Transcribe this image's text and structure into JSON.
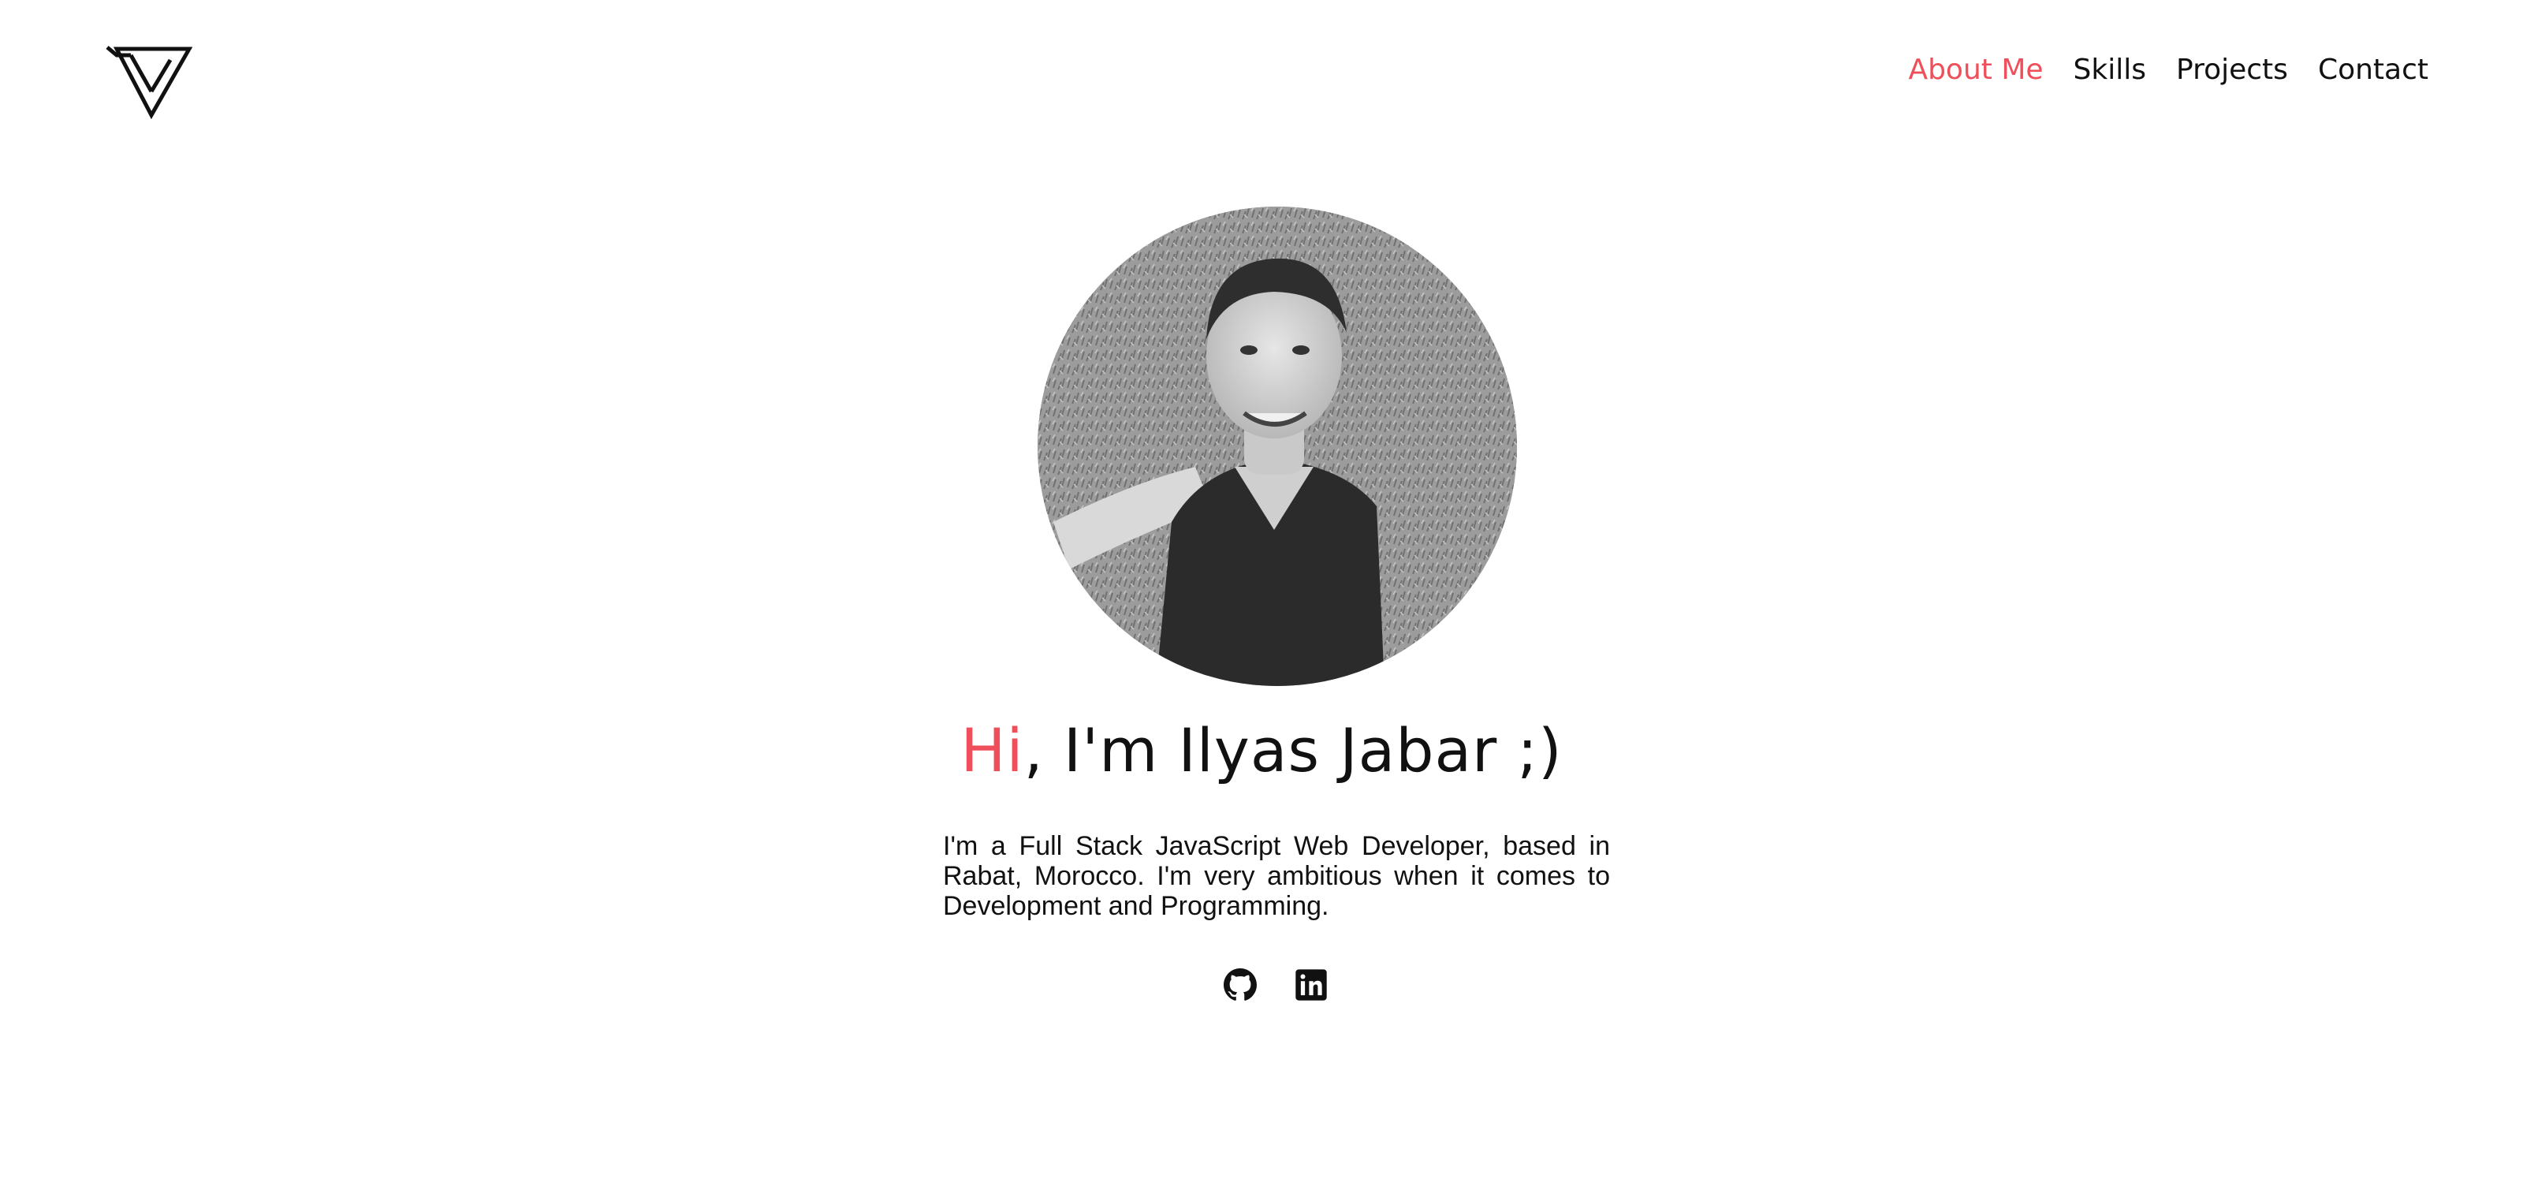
{
  "header": {
    "logo_icon": "triangle-logo-icon",
    "nav": [
      {
        "label": "About Me",
        "active": true
      },
      {
        "label": "Skills",
        "active": false
      },
      {
        "label": "Projects",
        "active": false
      },
      {
        "label": "Contact",
        "active": false
      }
    ]
  },
  "hero": {
    "avatar_icon": "profile-photo",
    "greeting": "Hi",
    "title_rest": ", I'm Ilyas Jabar ;)",
    "bio": "I'm a Full Stack JavaScript Web Developer, based in Rabat, Morocco. I'm very ambitious when it comes to Development and Programming.",
    "social": [
      {
        "icon": "github-icon"
      },
      {
        "icon": "linkedin-icon"
      }
    ]
  },
  "colors": {
    "accent": "#ef4f5a",
    "text": "#111111",
    "background": "#ffffff"
  }
}
